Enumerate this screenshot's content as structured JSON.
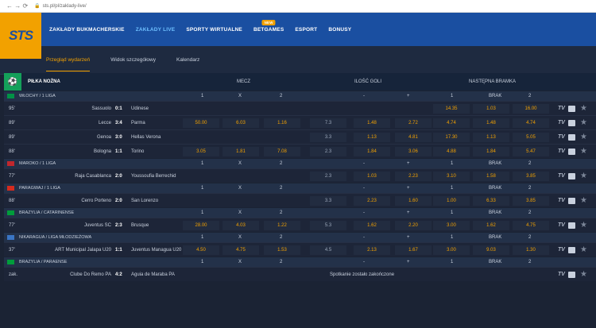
{
  "browser": {
    "url": "sts.pl/pl/zaklady-live/"
  },
  "logo": {
    "text": "STS"
  },
  "menu": [
    {
      "label": "ZAKŁADY BUKMACHERSKIE",
      "active": false,
      "badge": ""
    },
    {
      "label": "ZAKŁADY LIVE",
      "active": true,
      "badge": ""
    },
    {
      "label": "SPORTY WIRTUALNE",
      "active": false,
      "badge": ""
    },
    {
      "label": "BETGAMES",
      "active": false,
      "badge": "NEW"
    },
    {
      "label": "ESPORT",
      "active": false,
      "badge": ""
    },
    {
      "label": "BONUSY",
      "active": false,
      "badge": ""
    }
  ],
  "subtabs": [
    {
      "label": "Przegląd wydarzeń",
      "active": true
    },
    {
      "label": "Widok szczegółowy",
      "active": false
    },
    {
      "label": "Kalendarz",
      "active": false
    }
  ],
  "header": {
    "sport": "PIŁKA NOŻNA",
    "mecz": "MECZ",
    "ilosc": "ILOŚĆ GOLI",
    "nastepna": "NASTĘPNA BRAMKA"
  },
  "leagues": [
    {
      "name": "WŁOCHY / 1 LIGA",
      "flag": "#009246",
      "cols": [
        "1",
        "X",
        "2",
        "-",
        "+",
        "1",
        "BRAK",
        "2"
      ],
      "rows": [
        {
          "min": "95'",
          "home": "Sassuolo",
          "score": "0:1",
          "away": "Udinese",
          "m": [
            "",
            "",
            ""
          ],
          "g": [
            "",
            "",
            ""
          ],
          "n": [
            "14.35",
            "1.03",
            "16.00"
          ]
        },
        {
          "min": "89'",
          "home": "Lecce",
          "score": "3:4",
          "away": "Parma",
          "m": [
            "50.00",
            "6.03",
            "1.16"
          ],
          "g": [
            "7.3",
            "1.48",
            "2.72"
          ],
          "n": [
            "4.74",
            "1.48",
            "4.74"
          ]
        },
        {
          "min": "89'",
          "home": "Genoa",
          "score": "3:0",
          "away": "Hellas Verona",
          "m": [
            "",
            "",
            ""
          ],
          "g": [
            "3.3",
            "1.13",
            "4.81"
          ],
          "n": [
            "17.30",
            "1.13",
            "5.05"
          ]
        },
        {
          "min": "88'",
          "home": "Bologna",
          "score": "1:1",
          "away": "Torino",
          "m": [
            "3.05",
            "1.81",
            "7.08"
          ],
          "g": [
            "2.3",
            "1.84",
            "3.06"
          ],
          "n": [
            "4.88",
            "1.84",
            "5.47"
          ]
        }
      ]
    },
    {
      "name": "MAROKO / 1 LIGA",
      "flag": "#c1272d",
      "cols": [
        "1",
        "X",
        "2",
        "-",
        "+",
        "1",
        "BRAK",
        "2"
      ],
      "rows": [
        {
          "min": "77'",
          "home": "Raja Casablanca",
          "score": "2:0",
          "away": "Youssoufia Berrechid",
          "m": [
            "",
            "",
            ""
          ],
          "g": [
            "2.3",
            "1.03",
            "2.23"
          ],
          "n": [
            "3.10",
            "1.58",
            "3.85"
          ]
        }
      ]
    },
    {
      "name": "PARAGWAJ / 1 LIGA",
      "flag": "#d52b1e",
      "cols": [
        "1",
        "X",
        "2",
        "-",
        "+",
        "1",
        "BRAK",
        "2"
      ],
      "rows": [
        {
          "min": "88'",
          "home": "Cerro Porteno",
          "score": "2:0",
          "away": "San Lorenzo",
          "m": [
            "",
            "",
            ""
          ],
          "g": [
            "3.3",
            "2.23",
            "1.60"
          ],
          "n": [
            "1.00",
            "6.33",
            "3.85"
          ]
        }
      ]
    },
    {
      "name": "BRAZYLIA / CATARINENSE",
      "flag": "#009c3b",
      "cols": [
        "1",
        "X",
        "2",
        "-",
        "+",
        "1",
        "BRAK",
        "2"
      ],
      "rows": [
        {
          "min": "77'",
          "home": "Juventus SC",
          "score": "2:3",
          "away": "Brusque",
          "m": [
            "28.00",
            "4.03",
            "1.22"
          ],
          "g": [
            "5.3",
            "1.62",
            "2.20"
          ],
          "n": [
            "3.00",
            "1.62",
            "4.75"
          ]
        }
      ]
    },
    {
      "name": "NIKARAGUA / LIGA MŁODZIEŻOWA",
      "flag": "#3a75c4",
      "cols": [
        "1",
        "X",
        "2",
        "-",
        "+",
        "1",
        "BRAK",
        "2"
      ],
      "rows": [
        {
          "min": "37'",
          "home": "ART Municipal Jalapa U20",
          "score": "1:1",
          "away": "Juventus Managua U20",
          "m": [
            "4.50",
            "4.75",
            "1.53"
          ],
          "g": [
            "4.5",
            "2.13",
            "1.67"
          ],
          "n": [
            "3.00",
            "9.03",
            "1.30"
          ]
        }
      ]
    },
    {
      "name": "BRAZYLIA / PARAENSE",
      "flag": "#009c3b",
      "cols": [
        "1",
        "X",
        "2",
        "-",
        "+",
        "1",
        "BRAK",
        "2"
      ],
      "rows": [
        {
          "min": "zak.",
          "home": "Clube Do Remo PA",
          "score": "4:2",
          "away": "Aguia de Maraba PA",
          "m": [
            "",
            "",
            ""
          ],
          "g": [
            "",
            "",
            ""
          ],
          "n": [
            "",
            "",
            ""
          ],
          "msg": "Spotkanie zostało zakończone"
        }
      ]
    }
  ],
  "row_icons": {
    "tv": "TV",
    "stats": "stats-icon",
    "fav": "★"
  }
}
